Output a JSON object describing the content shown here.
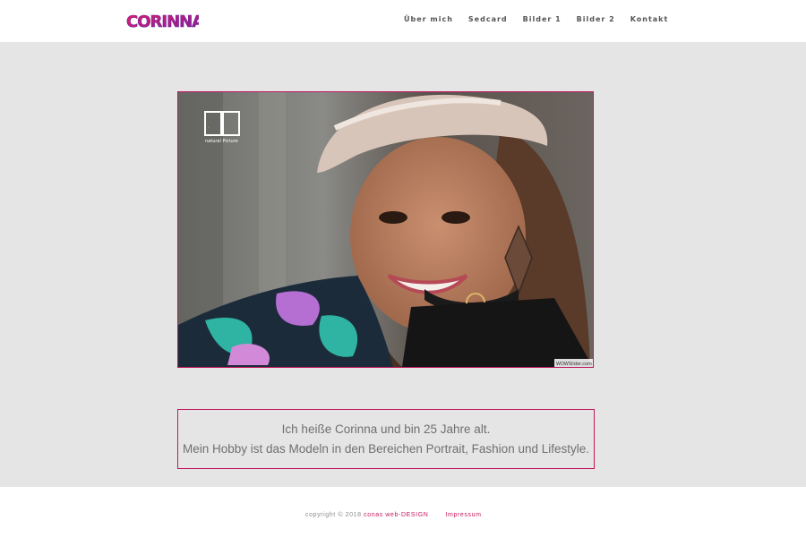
{
  "header": {
    "logo_text": "CORINNA",
    "nav": [
      "Über mich",
      "Sedcard",
      "Bilder 1",
      "Bilder 2",
      "Kontakt"
    ]
  },
  "photo": {
    "watermark_brand": "nP",
    "watermark_sub": "natural Picture",
    "corner_tag": "WOWSlider.com"
  },
  "intro": {
    "line1": "Ich heiße Corinna und bin 25 Jahre alt.",
    "line2": "Mein Hobby ist das Modeln in den Bereichen Portrait, Fashion und Lifestyle."
  },
  "footer": {
    "copyright": "copyright © 2018",
    "design_link": "conas web-DESIGN",
    "impressum_link": "Impressum"
  },
  "colors": {
    "accent": "#c2185b",
    "background_band": "#e5e5e5",
    "logo_purple": "#7b1fa2",
    "logo_pink": "#e91e63"
  }
}
